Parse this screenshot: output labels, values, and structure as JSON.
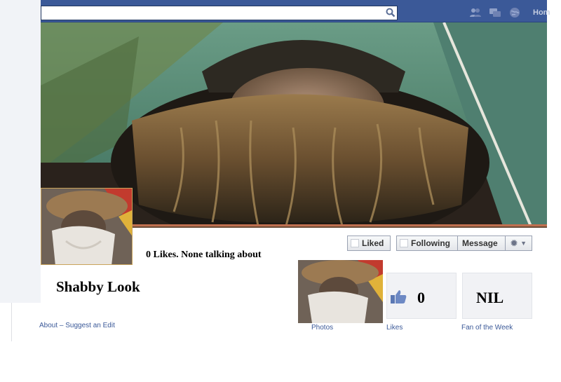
{
  "colors": {
    "facebook_blue": "#3b5998",
    "link": "#3b5998"
  },
  "topbar": {
    "search_placeholder": "",
    "home_label": "Hom"
  },
  "profile": {
    "name": "Shabby Look",
    "likes_text": "0 Likes. None talking about"
  },
  "actions": {
    "liked_label": "Liked",
    "following_label": "Following",
    "message_label": "Message",
    "settings_icon": "gear-icon"
  },
  "about": {
    "links_text": "About – Suggest an Edit"
  },
  "apps": {
    "photos_label": "Photos",
    "likes_label": "Likes",
    "likes_count": "0",
    "fan_label": "Fan of the Week",
    "fan_value": "NIL"
  }
}
